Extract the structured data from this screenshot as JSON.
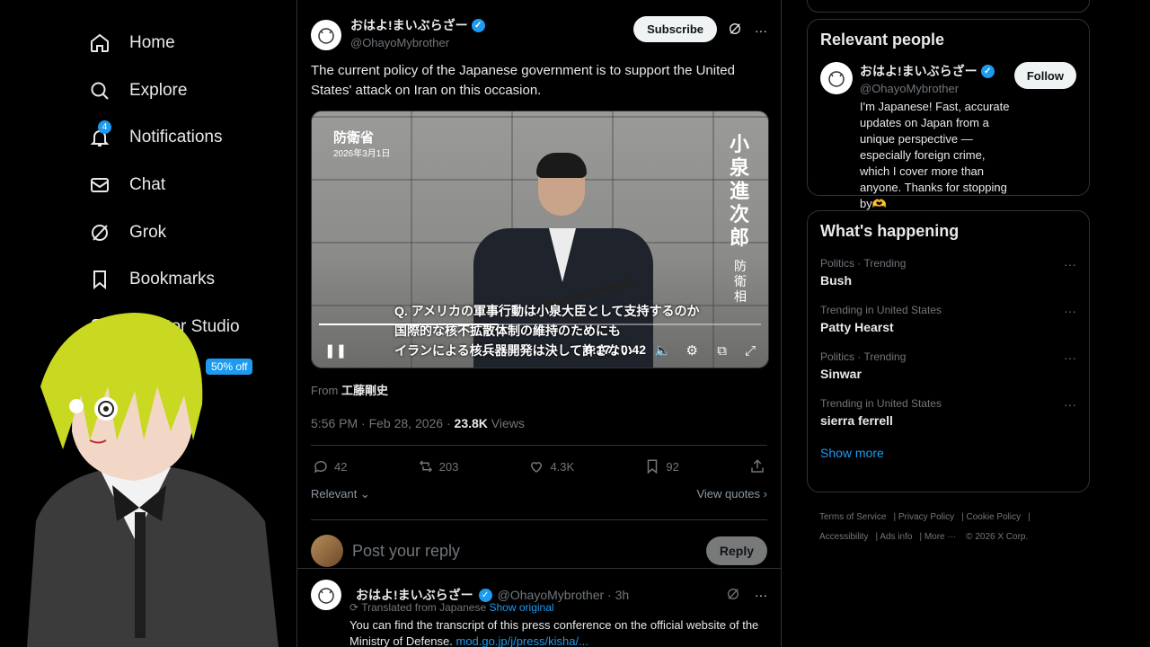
{
  "nav": {
    "items": [
      {
        "label": "Home",
        "icon": "home-icon"
      },
      {
        "label": "Explore",
        "icon": "search-icon"
      },
      {
        "label": "Notifications",
        "icon": "bell-icon",
        "badge": "4"
      },
      {
        "label": "Chat",
        "icon": "mail-icon"
      },
      {
        "label": "Grok",
        "icon": "grok-icon"
      },
      {
        "label": "Bookmarks",
        "icon": "bookmark-icon"
      },
      {
        "label": "Creator Studio",
        "icon": "studio-icon"
      }
    ],
    "promo": "50% off"
  },
  "post": {
    "author_name": "おはよ!まいぶらざー",
    "author_handle": "@OhayoMybrother",
    "subscribe_label": "Subscribe",
    "text": "The current policy of the Japanese government is to support the United States' attack on Iran on this occasion.",
    "video": {
      "org": "防衛省",
      "date": "2026年3月1日",
      "name_vertical": "小泉進次郎",
      "title_vertical": "防衛相",
      "subtitle_lines": [
        "Q. アメリカの軍事行動は小泉大臣として支持するのか",
        "国際的な核不拡散体制の維持のためにも",
        "イランによる核兵器開発は決して許さない"
      ],
      "time": "0:17 / 0:42",
      "progress": 0.405
    },
    "from_label": "From",
    "from_name": "工藤剛史",
    "timestamp": "5:56 PM · Feb 28, 2026 ·",
    "views_count": "23.8K",
    "views_label": "Views",
    "replies": "42",
    "reposts": "203",
    "likes": "4.3K",
    "bookmarks": "92",
    "sort_label": "Relevant",
    "view_quotes": "View quotes",
    "reply_placeholder": "Post your reply",
    "reply_button": "Reply"
  },
  "reply": {
    "author_name": "おはよ!まいぶらざー",
    "author_handle": "@OhayoMybrother · 3h",
    "translated": "Translated from Japanese",
    "show_original": "Show original",
    "text": "You can find the transcript of this press conference on the official website of the Ministry of Defense.",
    "link": "mod.go.jp/j/press/kisha/..."
  },
  "sidebar": {
    "relevant_title": "Relevant people",
    "person_name": "おはよ!まいぶらざー",
    "person_handle": "@OhayoMybrother",
    "follow_label": "Follow",
    "bio": "I'm Japanese! Fast, accurate updates on Japan from a unique perspective — especially foreign crime, which I cover more than anyone. Thanks for stopping by🫶",
    "happening_title": "What's happening",
    "trends": [
      {
        "context": "Politics · Trending",
        "title": "Bush"
      },
      {
        "context": "Trending in United States",
        "title": "Patty Hearst"
      },
      {
        "context": "Politics · Trending",
        "title": "Sinwar"
      },
      {
        "context": "Trending in United States",
        "title": "sierra ferrell"
      }
    ],
    "show_more": "Show more",
    "footer": [
      "Terms of Service",
      "Privacy Policy",
      "Cookie Policy",
      "Accessibility",
      "Ads info",
      "More ···",
      "© 2026 X Corp."
    ]
  }
}
